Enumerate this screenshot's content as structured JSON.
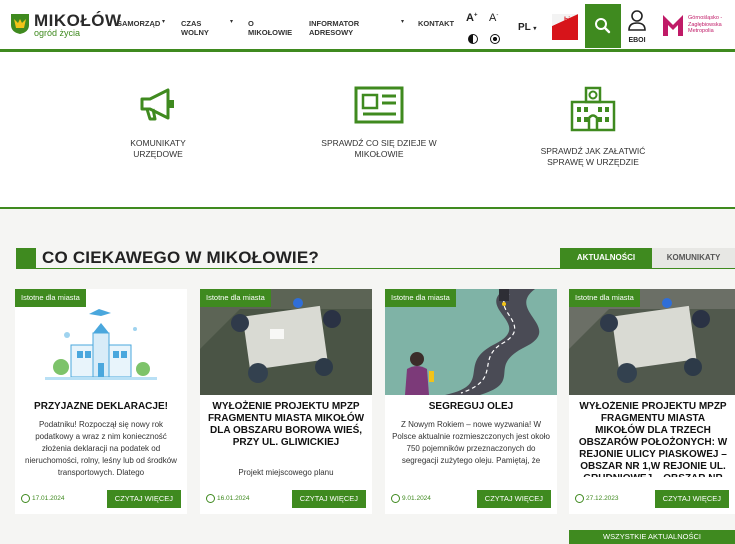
{
  "header": {
    "logo_name": "MIKOŁÓW",
    "logo_tagline": "ogród życia",
    "nav": [
      {
        "label": "SAMORZĄD"
      },
      {
        "label": "CZAS WOLNY"
      },
      {
        "label": "O MIKOŁOWIE"
      },
      {
        "label": "INFORMATOR ADRESOWY"
      },
      {
        "label": "KONTAKT"
      }
    ],
    "font_plus": "A",
    "font_minus": "A",
    "lang": "PL",
    "bip_label": "bip",
    "eboi_label": "EBOI",
    "metro_label": "Górnośląsko - Zagłębiowska Metropolia"
  },
  "quick_links": [
    {
      "label": "KOMUNIKATY URZĘDOWE",
      "icon": "megaphone-icon"
    },
    {
      "label": "SPRAWDŹ CO SIĘ DZIEJE W MIKOŁOWIE",
      "icon": "newspaper-icon"
    },
    {
      "label": "SPRAWDŹ JAK ZAŁATWIĆ SPRAWĘ W URZĘDZIE",
      "icon": "city-hall-icon"
    }
  ],
  "section": {
    "title": "CO CIEKAWEGO W MIKOŁOWIE?",
    "tab_active": "AKTUALNOŚCI",
    "tab_inactive": "KOMUNIKATY"
  },
  "cards": [
    {
      "badge": "Istotne dla miasta",
      "title": "PRZYJAZNE DEKLARACJE!",
      "text": "Podatniku! Rozpoczął się nowy rok podatkowy a wraz z nim konieczność złożenia deklaracji na podatek od nieruchomości, rolny, leśny lub od środków transportowych. Dlatego",
      "date": "17.01.2024",
      "more": "CZYTAJ WIĘCEJ"
    },
    {
      "badge": "Istotne dla miasta",
      "title": "WYŁOŻENIE PROJEKTU MPZP FRAGMENTU MIASTA MIKOŁÓW DLA OBSZARU BOROWA WIEŚ, PRZY UL. GLIWICKIEJ",
      "text": "Projekt miejscowego planu",
      "date": "16.01.2024",
      "more": "CZYTAJ WIĘCEJ"
    },
    {
      "badge": "Istotne dla miasta",
      "title": "SEGREGUJ OLEJ",
      "text": "Z Nowym Rokiem – nowe wyzwania! W Polsce aktualnie rozmieszczonych jest około 750 pojemników przeznaczonych do segregacji zużytego oleju. Pamiętaj, że",
      "date": "9.01.2024",
      "more": "CZYTAJ WIĘCEJ"
    },
    {
      "badge": "Istotne dla miasta",
      "title": "WYŁOŻENIE PROJEKTU MPZP FRAGMENTU MIASTA MIKOŁÓW DLA TRZECH OBSZARÓW POŁOŻONYCH: W REJONIE ULICY PIASKOWEJ – OBSZAR NR 1,W REJONIE UL. GRUDNIOWEJ – OBSZAR NR",
      "text": "",
      "date": "27.12.2023",
      "more": "CZYTAJ WIĘCEJ"
    }
  ],
  "all_news": "WSZYSTKIE AKTUALNOŚCI",
  "colors": {
    "brand_green": "#3f8a1f",
    "metro_pink": "#c01a67",
    "bip_red": "#d7141a"
  }
}
